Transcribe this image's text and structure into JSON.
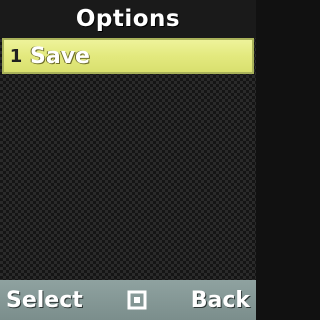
{
  "header": {
    "title": "Options"
  },
  "menu": {
    "items": [
      {
        "index": "1",
        "label": "Save"
      }
    ]
  },
  "softkeys": {
    "left_label": "Select",
    "center_icon": "select-square-icon",
    "right_label": "Back"
  },
  "colors": {
    "highlight": "#e3e97e",
    "softkey_bar": "#7b8e8c"
  }
}
